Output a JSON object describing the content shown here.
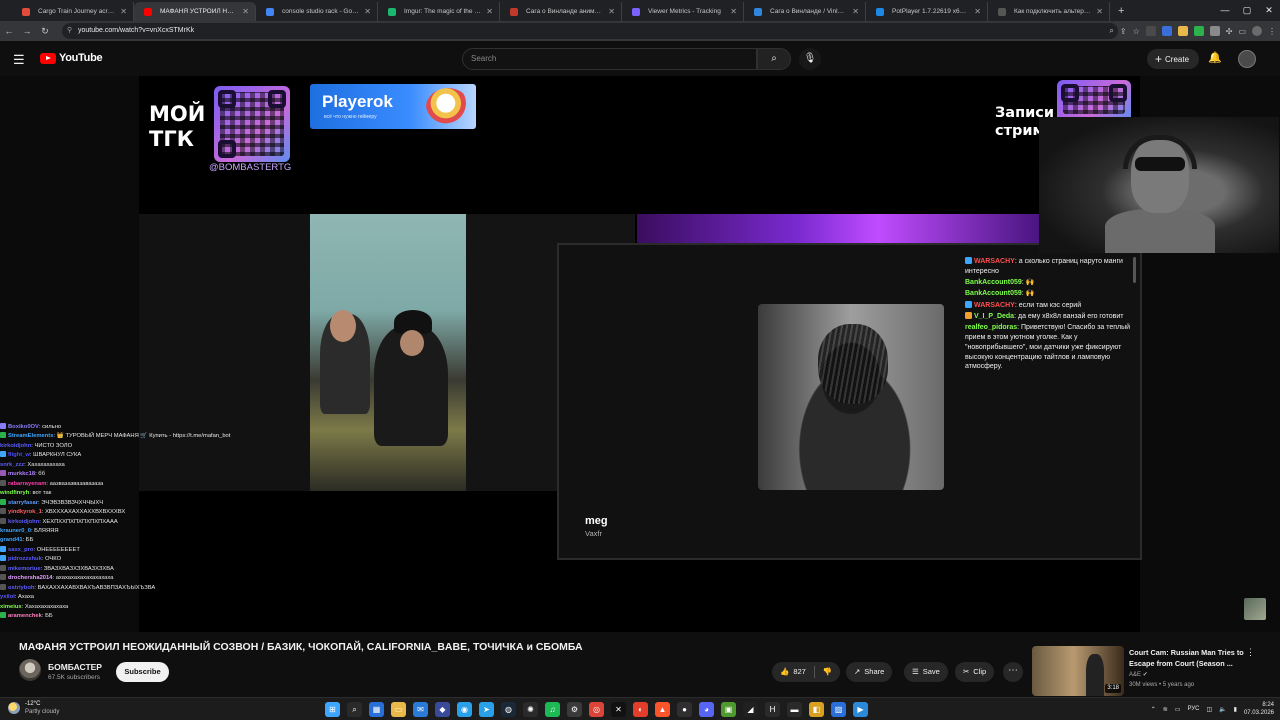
{
  "browser": {
    "tabs": [
      {
        "label": "Cargo Train Journey across Arg",
        "color": "#e34c3b",
        "active": false
      },
      {
        "label": "МАФАНЯ УСТРОИЛ НЕОЖИД",
        "color": "#ff0000",
        "active": true
      },
      {
        "label": "console studio rack - Google S",
        "color": "#4285f4",
        "active": false
      },
      {
        "label": "Imgur: The magic of the Intern",
        "color": "#1bb76e",
        "active": false
      },
      {
        "label": "Сага о Винланде аниме 2019",
        "color": "#c0392b",
        "active": false
      },
      {
        "label": "Viewer Metrics - Tracking",
        "color": "#7b61ff",
        "active": false
      },
      {
        "label": "Сага о Винланде / Vinland Sag",
        "color": "#2e86de",
        "active": false
      },
      {
        "label": "PotPlayer 1.7.22619 x64 RePack",
        "color": "#1e88e5",
        "active": false
      },
      {
        "label": "Как подключить альтернатив",
        "color": "#555555",
        "active": false
      }
    ],
    "new_tab": "+",
    "url": "youtube.com/watch?v=vnXcxSTMrKk"
  },
  "youtube": {
    "logo_text": "YouTube",
    "search_placeholder": "Search",
    "create_label": "Create"
  },
  "stream": {
    "tg_label_line1": "МОЙ",
    "tg_label_line2": "ТГК",
    "tg_handle": "@BOMBASTERTG",
    "ad_name": "Playerok",
    "ad_sub": "всё что нужно геймеру",
    "records_line1": "Записи",
    "records_line2": "стрим",
    "track_title": "meg",
    "track_artist": "Vaxfr"
  },
  "chat_right": [
    {
      "user": "WARSACHY",
      "color": "#ff4d4d",
      "icon": "#3ea6ff",
      "text": ": а сколько страниц наруто манги интересно"
    },
    {
      "user": "BankAccount059",
      "color": "#7fff4d",
      "icon": "",
      "text": ": 🙌"
    },
    {
      "user": "BankAccount059",
      "color": "#7fff4d",
      "icon": "",
      "text": ": 🙌"
    },
    {
      "user": "WARSACHY",
      "color": "#ff4d4d",
      "icon": "#3ea6ff",
      "text": ": если там кэс серий"
    },
    {
      "user": "V_I_P_Deda",
      "color": "#7fff4d",
      "icon": "#f0a030",
      "text": ": да ему х8х8л ванзай его готовит"
    },
    {
      "user": "realfeo_pidoras",
      "color": "#7fff4d",
      "icon": "",
      "text": ": Приветствую! Спасибо за теплый прием в этом уютном уголке. Как у \"новоприбывшего\", мои датчики уже фиксируют высокую концентрацию тайтлов и ламповую атмосферу."
    }
  ],
  "chat_left": [
    {
      "user": "Boxiko0OV",
      "color": "#8a7cff",
      "icon": "#8a7cff",
      "text": ": сильно"
    },
    {
      "user": "StreamElements",
      "color": "#3ea6ff",
      "icon": "#2bb24c",
      "text": ": 👑 ТУРОВЫЙ МЕРЧ МАФАНЯ 🛒 Купить - https://t.me/mafan_bot"
    },
    {
      "user": "kirkoidjohn",
      "color": "#5b5bff",
      "icon": "",
      "text": ": ЧИСТО ЗОЛО"
    },
    {
      "user": "flight_w",
      "color": "#4a4aff",
      "icon": "#3ea6ff",
      "text": ": ШВАРКНУЛ СУКА"
    },
    {
      "user": "snrk_zzz",
      "color": "#5b5bff",
      "icon": "",
      "text": ": Хахахахахаха"
    },
    {
      "user": "murkkc18",
      "color": "#b080ff",
      "icon": "#9b59b6",
      "text": ": бб"
    },
    {
      "user": "rabarrayenam",
      "color": "#ff3cac",
      "icon": "#555",
      "text": ": аазвазазвазавазаза"
    },
    {
      "user": "windfinryh",
      "color": "#7fff4d",
      "icon": "",
      "text": ": вот так"
    },
    {
      "user": "starryfasar",
      "color": "#5b9bff",
      "icon": "#2bb24c",
      "text": ": ЭЧЭВЗВЗВЗЧХЧЧЫХЧ"
    },
    {
      "user": "yindkyrok_1",
      "color": "#ff6060",
      "icon": "#555",
      "text": ": ХВХХХАХАХХАХХВХВХХХВХ"
    },
    {
      "user": "kirkoidjohn",
      "color": "#5b5bff",
      "icon": "#555",
      "text": ": ХЕХПХХПХПХПХПХПХААА"
    },
    {
      "user": "krauner0_0",
      "color": "#3ea6ff",
      "icon": "",
      "text": ": БЛЯЯЯЯ"
    },
    {
      "user": "grand41",
      "color": "#3ea6ff",
      "icon": "",
      "text": ": ББ"
    },
    {
      "user": "saxx_pro",
      "color": "#5b5bff",
      "icon": "#3ea6ff",
      "text": ": ОНЕЕЕЕЕЕЕЕТ"
    },
    {
      "user": "pidrozzshuk",
      "color": "#5b5bff",
      "icon": "#3ea6ff",
      "text": ": ОЧКО"
    },
    {
      "user": "mikemoriue",
      "color": "#5b5bff",
      "icon": "#555",
      "text": ": ЗВАЗХВАЗХЗХВАЗХЗХВА"
    },
    {
      "user": "drochersha2014",
      "color": "#e0a0ff",
      "icon": "#555",
      "text": ": ахахахахахахахахаха"
    },
    {
      "user": "ostriyboh",
      "color": "#5b5bff",
      "icon": "#555",
      "text": ": ВАХАХХАХАВХВАХЪАВЗВПЗАХЪЫХЪЗВА"
    },
    {
      "user": "yxilol",
      "color": "#5b5bff",
      "icon": "",
      "text": ": Ахаха"
    },
    {
      "user": "ximeiux",
      "color": "#7fff4d",
      "icon": "",
      "text": ": Хахахахахахаха"
    },
    {
      "user": "aramenchek",
      "color": "#ff7fbf",
      "icon": "#2bb24c",
      "text": ": ББ"
    }
  ],
  "video": {
    "title": "МАФАНЯ УСТРОИЛ НЕОЖИДАННЫЙ СОЗВОН / БАЗИК, ЧОКОПАЙ, CALIFORNIA_BABE, ТОЧИЧКА и СБОМБА",
    "channel": "БОМБАСТЕР",
    "subscribers": "67.5K subscribers",
    "subscribe_label": "Subscribe",
    "likes": "827",
    "share_label": "Share",
    "save_label": "Save",
    "clip_label": "Clip"
  },
  "recommended": {
    "title": "Court Cam: Russian Man Tries to Escape from Court (Season ...",
    "channel": "A&E",
    "meta": "30M views • 5 years ago",
    "duration": "3:18"
  },
  "taskbar": {
    "temperature": "-12°C",
    "weather": "Partly cloudy",
    "lang": "РУС",
    "time": "8:24",
    "date": "07.03.2026",
    "icons": [
      {
        "name": "windows-start-icon",
        "color": "#3ea6ff",
        "glyph": "⊞"
      },
      {
        "name": "search-icon",
        "color": "#2a2a2a",
        "glyph": "⌕"
      },
      {
        "name": "widgets-icon",
        "color": "#2a6fd8",
        "glyph": "▦"
      },
      {
        "name": "file-explorer-icon",
        "color": "#e8b84a",
        "glyph": "▭"
      },
      {
        "name": "mail-icon",
        "color": "#2a7bd8",
        "glyph": "✉"
      },
      {
        "name": "vpn-icon",
        "color": "#3a4a9a",
        "glyph": "◆"
      },
      {
        "name": "browser-alt-icon",
        "color": "#2aa0e8",
        "glyph": "◉"
      },
      {
        "name": "telegram-icon",
        "color": "#2aa0e8",
        "glyph": "➤"
      },
      {
        "name": "steam-icon",
        "color": "#1b2838",
        "glyph": "◍"
      },
      {
        "name": "chatgpt-icon",
        "color": "#2a2a2a",
        "glyph": "✺"
      },
      {
        "name": "spotify-icon",
        "color": "#1db954",
        "glyph": "♫"
      },
      {
        "name": "settings-icon",
        "color": "#3a3a3a",
        "glyph": "⚙"
      },
      {
        "name": "chrome-icon",
        "color": "#db4437",
        "glyph": "◎"
      },
      {
        "name": "capcut-icon",
        "color": "#111111",
        "glyph": "✕"
      },
      {
        "name": "yandex-browser-icon",
        "color": "#e33d2b",
        "glyph": "◐"
      },
      {
        "name": "brave-icon",
        "color": "#fb542b",
        "glyph": "▲"
      },
      {
        "name": "obs-icon",
        "color": "#302e31",
        "glyph": "●"
      },
      {
        "name": "discord-icon",
        "color": "#5865f2",
        "glyph": "◕"
      },
      {
        "name": "minecraft-icon",
        "color": "#4e9a2e",
        "glyph": "▣"
      },
      {
        "name": "app-dark-icon",
        "color": "#202020",
        "glyph": "◢"
      },
      {
        "name": "hype-icon",
        "color": "#2a2a2a",
        "glyph": "H"
      },
      {
        "name": "terminal-icon",
        "color": "#2a2a2a",
        "glyph": "▬"
      },
      {
        "name": "app-yellow-icon",
        "color": "#d8a020",
        "glyph": "◧"
      },
      {
        "name": "photos-icon",
        "color": "#2a6fd8",
        "glyph": "▨"
      },
      {
        "name": "media-player-icon",
        "color": "#2a8ad8",
        "glyph": "▶"
      }
    ]
  }
}
